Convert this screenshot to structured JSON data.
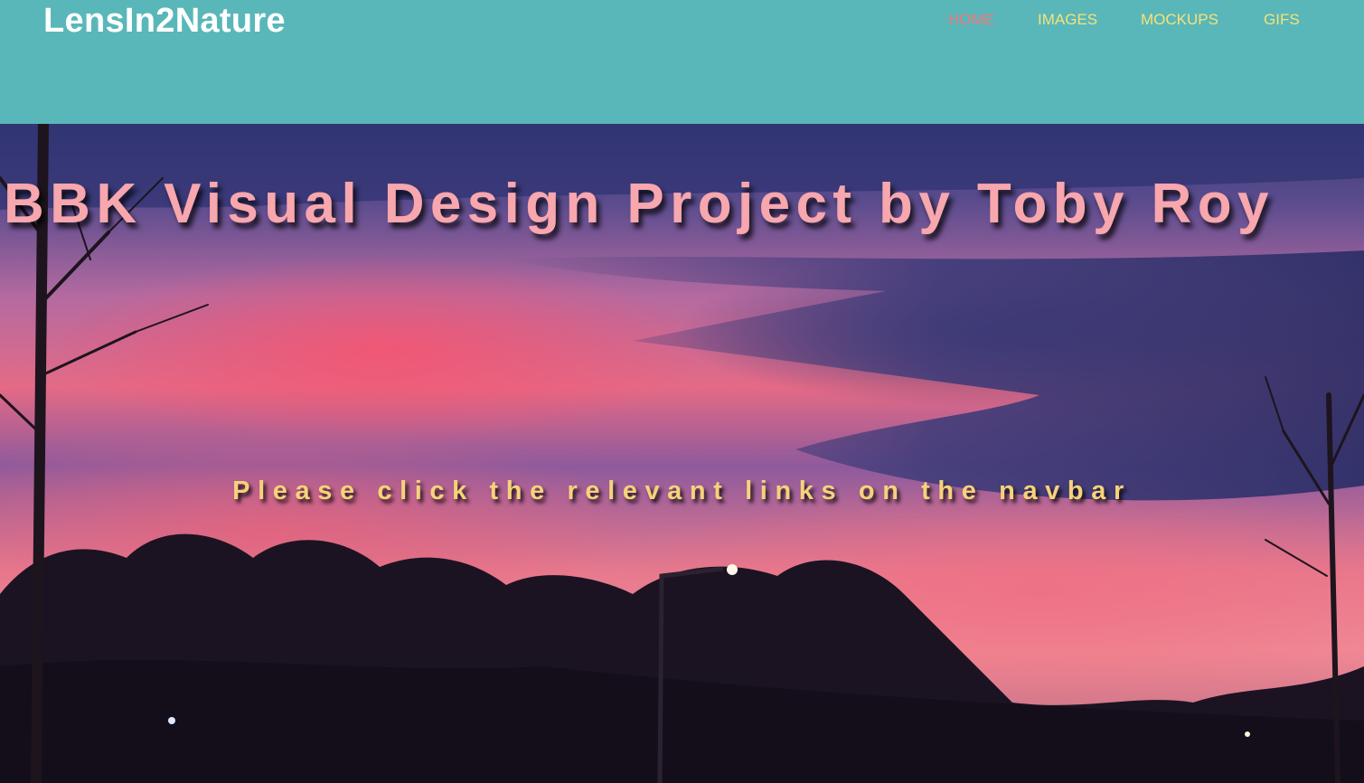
{
  "brand": "LensIn2Nature",
  "nav": {
    "items": [
      {
        "label": "HOME",
        "color": "#f0787f",
        "active": true
      },
      {
        "label": "IMAGES",
        "color": "#f6e27a",
        "active": false
      },
      {
        "label": "MOCKUPS",
        "color": "#f6e27a",
        "active": false
      },
      {
        "label": "GIFS",
        "color": "#f6e27a",
        "active": false
      }
    ]
  },
  "hero": {
    "title": "BBK Visual Design Project by Toby Roy",
    "subtitle": "Please click the relevant links on the navbar"
  },
  "colors": {
    "navbar_bg": "#59b7b9",
    "title_text": "#f7a7ad",
    "subtitle_text": "#f6d27a"
  }
}
